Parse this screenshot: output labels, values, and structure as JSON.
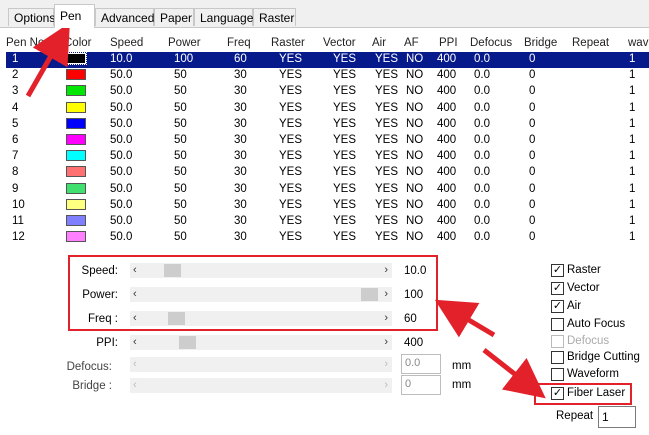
{
  "tabs": [
    "Options",
    "Pen",
    "Advanced",
    "Paper",
    "Language",
    "Raster"
  ],
  "active_tab": "Pen",
  "columns": [
    "Pen No.",
    "Color",
    "Speed",
    "Power",
    "Freq",
    "Raster",
    "Vector",
    "Air",
    "AF",
    "PPI",
    "Defocus",
    "Bridge",
    "Repeat",
    "wav"
  ],
  "pens": [
    {
      "no": "1",
      "color": "#000000",
      "speed": "10.0",
      "power": "100",
      "freq": "60",
      "raster": "YES",
      "vector": "YES",
      "air": "YES",
      "af": "NO",
      "ppi": "400",
      "defocus": "0.0",
      "bridge": "0",
      "wave": "1"
    },
    {
      "no": "2",
      "color": "#ff0000",
      "speed": "50.0",
      "power": "50",
      "freq": "30",
      "raster": "YES",
      "vector": "YES",
      "air": "YES",
      "af": "NO",
      "ppi": "400",
      "defocus": "0.0",
      "bridge": "0",
      "wave": "1"
    },
    {
      "no": "3",
      "color": "#00e600",
      "speed": "50.0",
      "power": "50",
      "freq": "30",
      "raster": "YES",
      "vector": "YES",
      "air": "YES",
      "af": "NO",
      "ppi": "400",
      "defocus": "0.0",
      "bridge": "0",
      "wave": "1"
    },
    {
      "no": "4",
      "color": "#ffff00",
      "speed": "50.0",
      "power": "50",
      "freq": "30",
      "raster": "YES",
      "vector": "YES",
      "air": "YES",
      "af": "NO",
      "ppi": "400",
      "defocus": "0.0",
      "bridge": "0",
      "wave": "1"
    },
    {
      "no": "5",
      "color": "#0000ff",
      "speed": "50.0",
      "power": "50",
      "freq": "30",
      "raster": "YES",
      "vector": "YES",
      "air": "YES",
      "af": "NO",
      "ppi": "400",
      "defocus": "0.0",
      "bridge": "0",
      "wave": "1"
    },
    {
      "no": "6",
      "color": "#ff00ff",
      "speed": "50.0",
      "power": "50",
      "freq": "30",
      "raster": "YES",
      "vector": "YES",
      "air": "YES",
      "af": "NO",
      "ppi": "400",
      "defocus": "0.0",
      "bridge": "0",
      "wave": "1"
    },
    {
      "no": "7",
      "color": "#00ffff",
      "speed": "50.0",
      "power": "50",
      "freq": "30",
      "raster": "YES",
      "vector": "YES",
      "air": "YES",
      "af": "NO",
      "ppi": "400",
      "defocus": "0.0",
      "bridge": "0",
      "wave": "1"
    },
    {
      "no": "8",
      "color": "#ff7070",
      "speed": "50.0",
      "power": "50",
      "freq": "30",
      "raster": "YES",
      "vector": "YES",
      "air": "YES",
      "af": "NO",
      "ppi": "400",
      "defocus": "0.0",
      "bridge": "0",
      "wave": "1"
    },
    {
      "no": "9",
      "color": "#40e070",
      "speed": "50.0",
      "power": "50",
      "freq": "30",
      "raster": "YES",
      "vector": "YES",
      "air": "YES",
      "af": "NO",
      "ppi": "400",
      "defocus": "0.0",
      "bridge": "0",
      "wave": "1"
    },
    {
      "no": "10",
      "color": "#ffff80",
      "speed": "50.0",
      "power": "50",
      "freq": "30",
      "raster": "YES",
      "vector": "YES",
      "air": "YES",
      "af": "NO",
      "ppi": "400",
      "defocus": "0.0",
      "bridge": "0",
      "wave": "1"
    },
    {
      "no": "11",
      "color": "#8080ff",
      "speed": "50.0",
      "power": "50",
      "freq": "30",
      "raster": "YES",
      "vector": "YES",
      "air": "YES",
      "af": "NO",
      "ppi": "400",
      "defocus": "0.0",
      "bridge": "0",
      "wave": "1"
    },
    {
      "no": "12",
      "color": "#ff80ff",
      "speed": "50.0",
      "power": "50",
      "freq": "30",
      "raster": "YES",
      "vector": "YES",
      "air": "YES",
      "af": "NO",
      "ppi": "400",
      "defocus": "0.0",
      "bridge": "0",
      "wave": "1"
    }
  ],
  "selected_pen": "1",
  "sliders": [
    {
      "label": "Speed:",
      "value": "10.0",
      "level": 0.09,
      "enabled": true
    },
    {
      "label": "Power:",
      "value": "100",
      "level": 1.0,
      "enabled": true
    },
    {
      "label": "Freq :",
      "value": "60",
      "level": 0.11,
      "enabled": true
    },
    {
      "label": "PPI:",
      "value": "400",
      "level": 0.16,
      "enabled": true
    },
    {
      "label": "Defocus:",
      "value": "",
      "enabled": false
    },
    {
      "label": "Bridge :",
      "value": "",
      "enabled": false
    }
  ],
  "defocus_box": "0.0",
  "bridge_box": "0",
  "unit_mm": "mm",
  "checkboxes": [
    {
      "label": "Raster",
      "checked": true,
      "enabled": true
    },
    {
      "label": "Vector",
      "checked": true,
      "enabled": true
    },
    {
      "label": "Air",
      "checked": true,
      "enabled": true
    },
    {
      "label": "Auto Focus",
      "checked": false,
      "enabled": true
    },
    {
      "label": "Defocus",
      "checked": false,
      "enabled": false
    },
    {
      "label": "Bridge Cutting",
      "checked": false,
      "enabled": true
    },
    {
      "label": "Waveform",
      "checked": false,
      "enabled": true
    },
    {
      "label": "Fiber Laser",
      "checked": true,
      "enabled": true
    }
  ],
  "repeat_label": "Repeat",
  "repeat_value": "1",
  "colors": {
    "selection": "#071a8c",
    "annotation": "#e3212b"
  }
}
